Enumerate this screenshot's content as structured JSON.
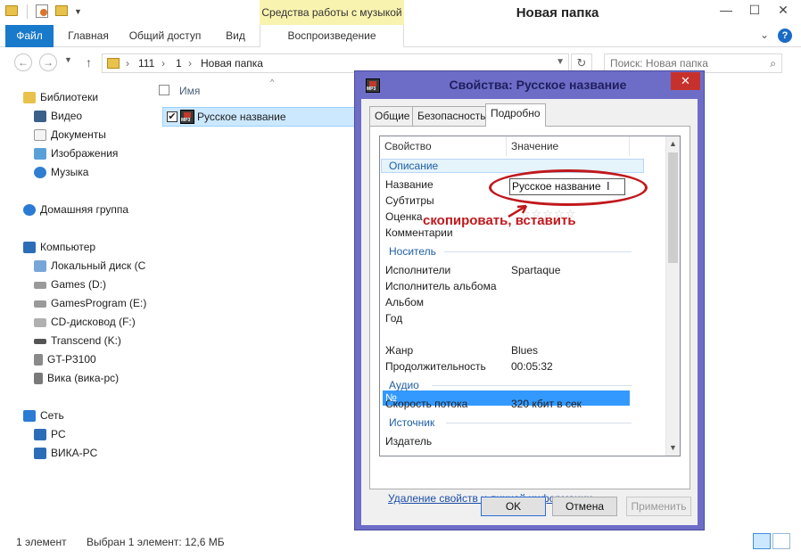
{
  "titlebar": {
    "title": "Новая папка",
    "context_tab": "Средства работы с музыкой",
    "minimize": "—",
    "maximize": "☐",
    "close": "✕"
  },
  "ribbon": {
    "tabs": [
      "Файл",
      "Главная",
      "Общий доступ",
      "Вид"
    ],
    "context_sub": "Воспроизведение",
    "help": "?"
  },
  "address": {
    "crumbs": [
      "111",
      "1",
      "Новая папка"
    ],
    "search_placeholder": "Поиск: Новая папка"
  },
  "nav": {
    "libraries": "Библиотеки",
    "lib_items": [
      "Видео",
      "Документы",
      "Изображения",
      "Музыка"
    ],
    "homegroup": "Домашняя группа",
    "computer": "Компьютер",
    "drives": [
      "Локальный диск (С",
      "Games (D:)",
      "GamesProgram (E:)",
      "CD-дисковод (F:)",
      "Transcend (K:)",
      "GT-P3100",
      "Вика (вика-pc)"
    ],
    "network": "Сеть",
    "net_items": [
      "PC",
      "ВИКА-PC"
    ]
  },
  "filelist": {
    "col_name": "Имя",
    "file": "Русское название"
  },
  "status": {
    "count": "1 элемент",
    "selected": "Выбран 1 элемент: 12,6 МБ"
  },
  "dialog": {
    "title": "Свойства: Русское название",
    "tabs": [
      "Общие",
      "Безопасность",
      "Подробно"
    ],
    "columns": [
      "Свойство",
      "Значение"
    ],
    "groups": [
      "Описание",
      "Носитель",
      "Аудио",
      "Источник"
    ],
    "desc_props": [
      "Название",
      "Субтитры",
      "Оценка",
      "Комментарии"
    ],
    "title_value": "Русское название",
    "media_props": [
      "Исполнители",
      "Исполнитель альбома",
      "Альбом",
      "Год",
      "№",
      "Жанр",
      "Продолжительность"
    ],
    "media_values": [
      "Spartaque",
      "",
      "",
      "",
      "",
      "Blues",
      "00:05:32"
    ],
    "audio_props": [
      "Скорость потока"
    ],
    "audio_values": [
      "320 кбит в сек"
    ],
    "source_props": [
      "Издатель"
    ],
    "annotation": "скопировать, вставить",
    "link": "Удаление свойств и личной информации",
    "buttons": [
      "OK",
      "Отмена",
      "Применить"
    ]
  },
  "colors": {
    "accent": "#1979ca",
    "dialog_frame": "#6d6dc8",
    "annotation": "#c0181c",
    "selection": "#3399ff"
  }
}
